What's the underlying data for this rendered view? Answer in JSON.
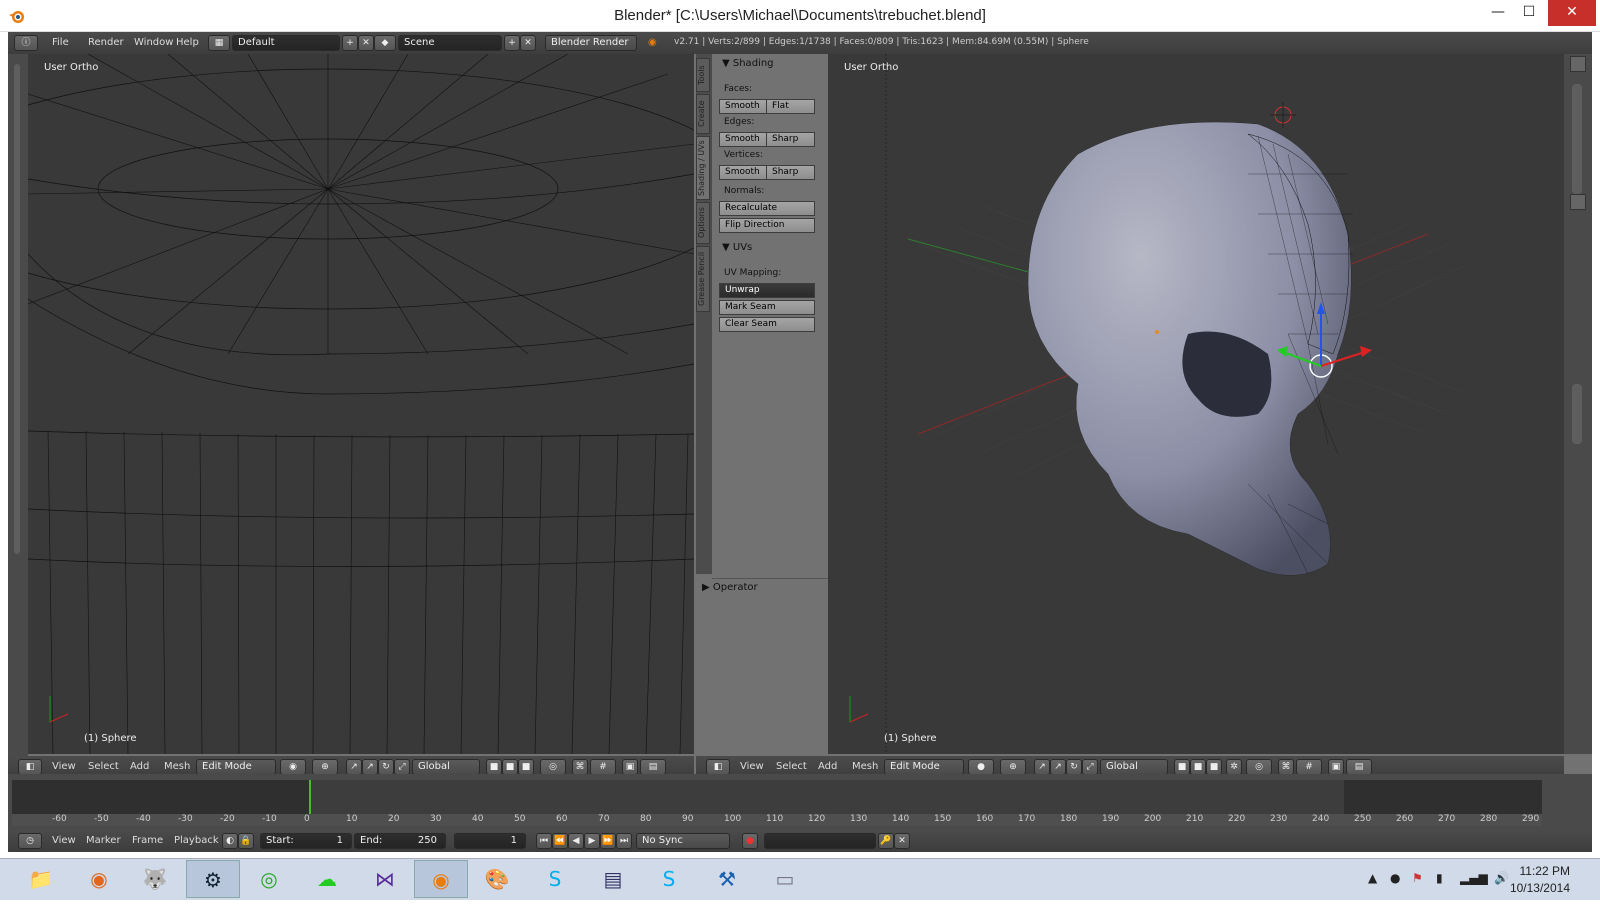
{
  "window": {
    "title": "Blender* [C:\\Users\\Michael\\Documents\\trebuchet.blend]",
    "minimize": "—",
    "maximize": "☐",
    "close": "✕"
  },
  "info_header": {
    "menus": [
      "File",
      "Render",
      "Window",
      "Help"
    ],
    "layout": "Default",
    "scene": "Scene",
    "engine": "Blender Render",
    "stats": "v2.71 | Verts:2/899 | Edges:1/1738 | Faces:0/809 | Tris:1623 | Mem:84.69M (0.55M) | Sphere"
  },
  "left_viewport": {
    "label": "User Ortho",
    "object": "(1) Sphere"
  },
  "right_viewport": {
    "label": "User Ortho",
    "object": "(1) Sphere"
  },
  "tool_tabs": [
    "Tools",
    "Create",
    "Shading / UVs",
    "Options",
    "Grease Pencil"
  ],
  "tool_panel": {
    "shading_title": "Shading",
    "faces_label": "Faces:",
    "faces": [
      "Smooth",
      "Flat"
    ],
    "edges_label": "Edges:",
    "edges": [
      "Smooth",
      "Sharp"
    ],
    "vertices_label": "Vertices:",
    "vertices": [
      "Smooth",
      "Sharp"
    ],
    "normals_label": "Normals:",
    "recalculate": "Recalculate",
    "flip": "Flip Direction",
    "uvs_title": "UVs",
    "uv_mapping_label": "UV Mapping:",
    "unwrap": "Unwrap",
    "mark_seam": "Mark Seam",
    "clear_seam": "Clear Seam",
    "operator": "Operator"
  },
  "viewport_header": {
    "menus": [
      "View",
      "Select",
      "Add",
      "Mesh"
    ],
    "mode": "Edit Mode",
    "orientation": "Global"
  },
  "timeline": {
    "ticks": [
      "-60",
      "-50",
      "-40",
      "-30",
      "-20",
      "-10",
      "0",
      "10",
      "20",
      "30",
      "40",
      "50",
      "60",
      "70",
      "80",
      "90",
      "100",
      "110",
      "120",
      "130",
      "140",
      "150",
      "160",
      "170",
      "180",
      "190",
      "200",
      "210",
      "220",
      "230",
      "240",
      "250",
      "260",
      "270",
      "280",
      "290"
    ],
    "menus": [
      "View",
      "Marker",
      "Frame",
      "Playback"
    ],
    "start": "Start:",
    "start_val": "1",
    "end": "End:",
    "end_val": "250",
    "current": "1",
    "sync": "No Sync"
  },
  "taskbar": {
    "apps": [
      "file-explorer-icon",
      "firefox-icon",
      "gimp-icon",
      "steam-icon",
      "razer-icon",
      "cloud-icon",
      "visual-studio-icon",
      "blender-icon",
      "paint-icon",
      "skype-icon",
      "notepad-icon",
      "skype-business-icon",
      "hammer-icon",
      "monitor-icon"
    ],
    "time": "11:22 PM",
    "date": "10/13/2014"
  },
  "colors": {
    "viewport_bg": "#393939",
    "panel_bg": "#727272",
    "mesh": "#8c8ea6",
    "close_btn": "#c7302a"
  }
}
